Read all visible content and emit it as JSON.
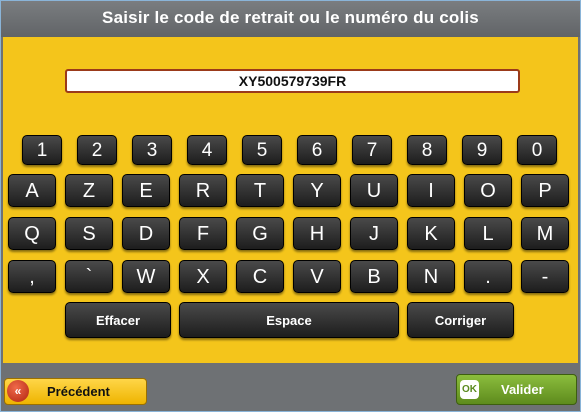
{
  "header": {
    "title": "Saisir le code de retrait ou le numéro du colis"
  },
  "input": {
    "value": "XY500579739FR"
  },
  "keyboard": {
    "numbers": [
      "1",
      "2",
      "3",
      "4",
      "5",
      "6",
      "7",
      "8",
      "9",
      "0"
    ],
    "row1": [
      "A",
      "Z",
      "E",
      "R",
      "T",
      "Y",
      "U",
      "I",
      "O",
      "P"
    ],
    "row2": [
      "Q",
      "S",
      "D",
      "F",
      "G",
      "H",
      "J",
      "K",
      "L",
      "M"
    ],
    "row3": [
      ",",
      "`",
      "W",
      "X",
      "C",
      "V",
      "B",
      "N",
      ".",
      "-"
    ],
    "erase_label": "Effacer",
    "space_label": "Espace",
    "correct_label": "Corriger"
  },
  "footer": {
    "prev_label": "Précédent",
    "prev_icon": "double-chevron-left-icon",
    "ok_label": "Valider",
    "ok_icon_text": "OK",
    "ok_icon": "ok-badge-icon"
  }
}
